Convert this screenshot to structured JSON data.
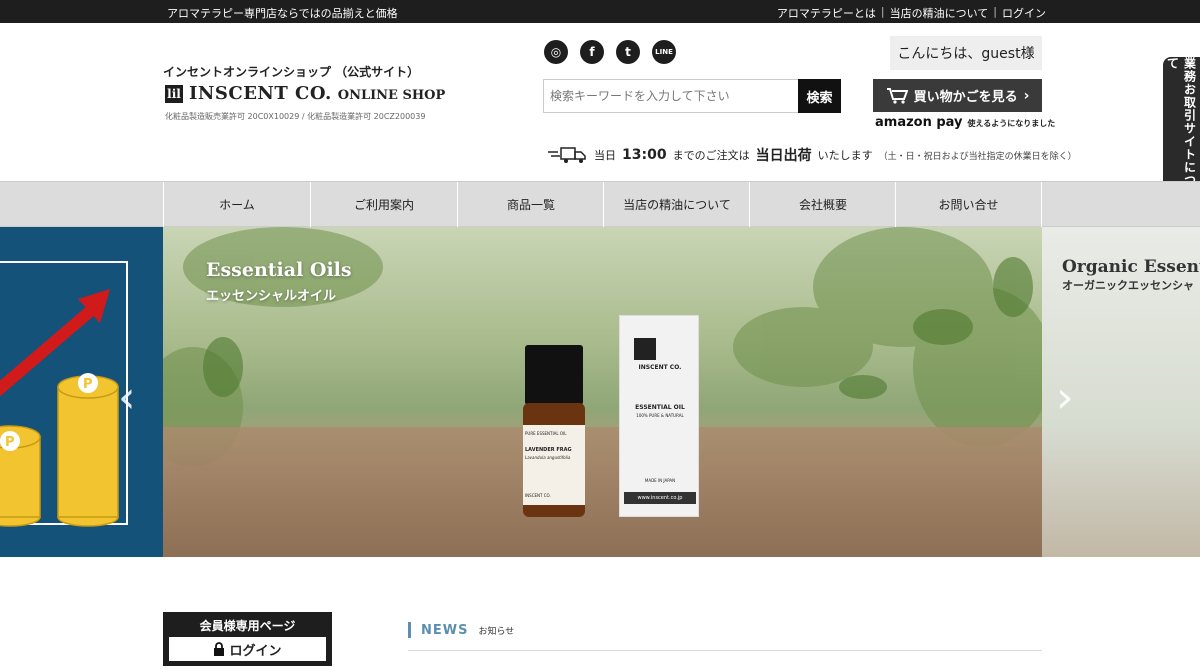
{
  "topbar": {
    "tagline": "アロマテラピー専門店ならではの品揃えと価格",
    "links": [
      "アロマテラピーとは",
      "当店の精油について",
      "ログイン"
    ],
    "separator": "|"
  },
  "header": {
    "shop_subtitle": "インセントオンラインショップ （公式サイト）",
    "logo_mark": "lil",
    "logo_main": "INSCENT CO.",
    "logo_online": "ONLINE SHOP",
    "license": "化粧品製造販売業許可 20C0X10029 / 化粧品製造業許可 20CZ200039",
    "social": [
      {
        "name": "instagram-icon",
        "glyph": "◎"
      },
      {
        "name": "facebook-icon",
        "glyph": "f"
      },
      {
        "name": "twitter-icon",
        "glyph": "t"
      },
      {
        "name": "line-icon",
        "glyph": "LINE"
      }
    ],
    "search_placeholder": "検索キーワードを入力して下さい",
    "search_button": "検索",
    "greeting": "こんにちは、guest様",
    "cart_label": "買い物かごを見る",
    "amazon_pay_logo": "amazon pay",
    "amazon_pay_note": "使えるようになりました",
    "shipping": {
      "pre": "当日",
      "time": "13:00",
      "mid": "までのご注文は",
      "bold": "当日出荷",
      "post": "いたします",
      "note": "（土・日・祝日および当社指定の休業日を除く）"
    }
  },
  "side_tab": "業務お取引サイトについて",
  "nav": {
    "items": [
      "ホーム",
      "ご利用案内",
      "商品一覧",
      "当店の精油について",
      "会社概要",
      "お問い合せ"
    ]
  },
  "hero": {
    "main_title": "Essential Oils",
    "main_subtitle": "エッセンシャルオイル",
    "right_title": "Organic Essenti",
    "right_subtitle": "オーガニックエッセンシャ",
    "prev_arrow": "‹",
    "next_arrow": "›",
    "bottle_label": {
      "top": "PURE ESSENTIAL OIL",
      "name": "LAVENDER FRAG",
      "latin": "Lavandula angustifolia",
      "brand": "INSCENT CO."
    },
    "box": {
      "brand": "INSCENT CO.",
      "product": "ESSENTIAL OIL",
      "purity": "100% PURE & NATURAL",
      "made": "MADE IN JAPAN",
      "url": "www.inscent.co.jp"
    }
  },
  "member": {
    "title": "会員様専用ページ",
    "login": "ログイン",
    "lock_icon": "🔒"
  },
  "news": {
    "title": "NEWS",
    "subtitle": "お知らせ"
  },
  "colors": {
    "dark": "#1e1e1e",
    "nav_bg": "#dcdcdc",
    "news_accent": "#5b8fb0",
    "hero_left_bg": "#14527a"
  }
}
